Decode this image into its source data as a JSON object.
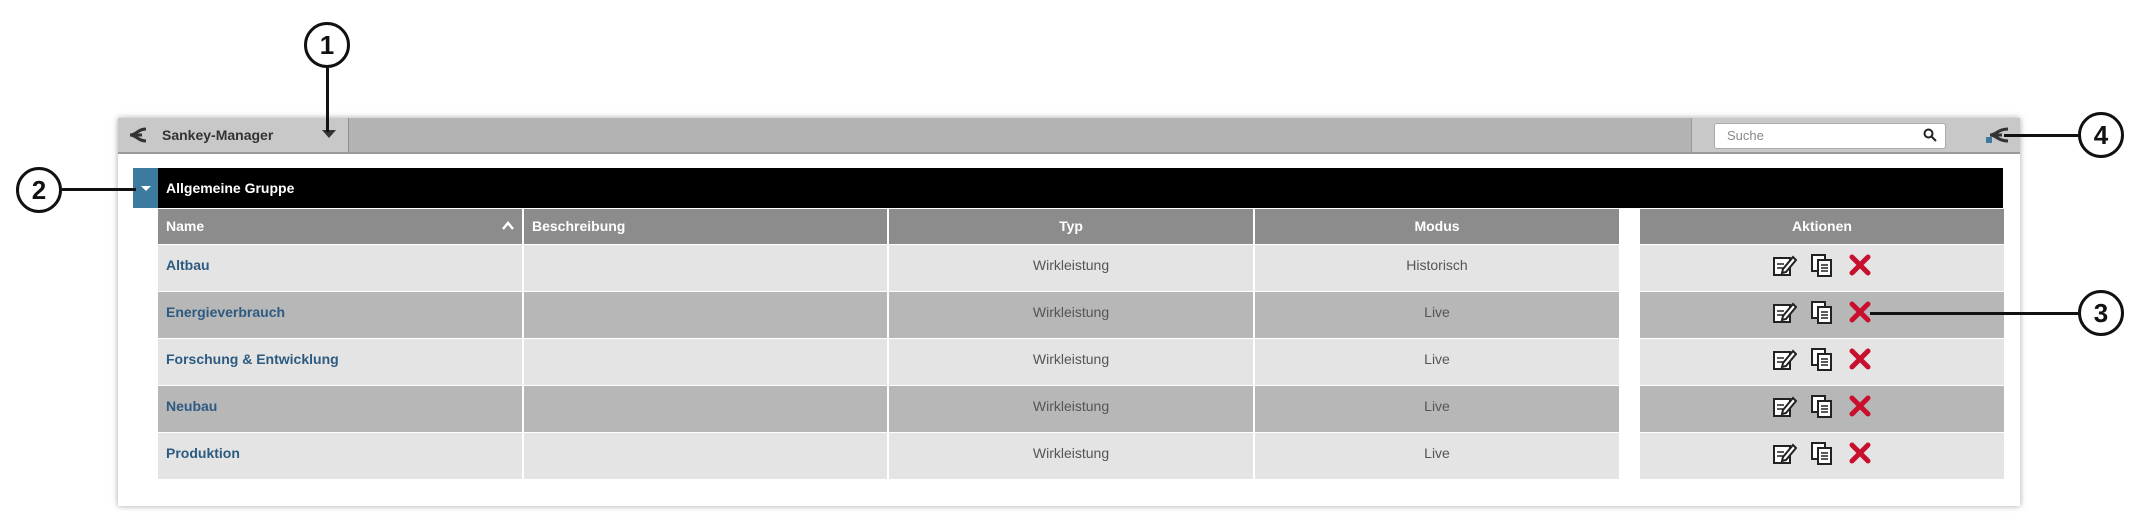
{
  "app": {
    "title": "Sankey-Manager",
    "search": {
      "placeholder": "Suche",
      "value": ""
    }
  },
  "group": {
    "title": "Allgemeine Gruppe"
  },
  "table": {
    "headers": {
      "name": "Name",
      "beschreibung": "Beschreibung",
      "typ": "Typ",
      "modus": "Modus",
      "aktionen": "Aktionen"
    },
    "sort": {
      "column": "Name",
      "direction": "ascending"
    },
    "rows": [
      {
        "name": "Altbau",
        "beschreibung": "",
        "typ": "Wirkleistung",
        "modus": "Historisch"
      },
      {
        "name": "Energieverbrauch",
        "beschreibung": "",
        "typ": "Wirkleistung",
        "modus": "Live"
      },
      {
        "name": "Forschung & Entwicklung",
        "beschreibung": "",
        "typ": "Wirkleistung",
        "modus": "Live"
      },
      {
        "name": "Neubau",
        "beschreibung": "",
        "typ": "Wirkleistung",
        "modus": "Live"
      },
      {
        "name": "Produktion",
        "beschreibung": "",
        "typ": "Wirkleistung",
        "modus": "Live"
      }
    ],
    "action_icons": [
      "edit-icon",
      "copy-icon",
      "delete-icon"
    ]
  },
  "callouts": [
    "1",
    "2",
    "3",
    "4"
  ],
  "colors": {
    "group_bar": "#000000",
    "group_toggle": "#3c7aa0",
    "link": "#2c5a80",
    "delete": "#c8102e",
    "header": "#8c8c8c"
  }
}
